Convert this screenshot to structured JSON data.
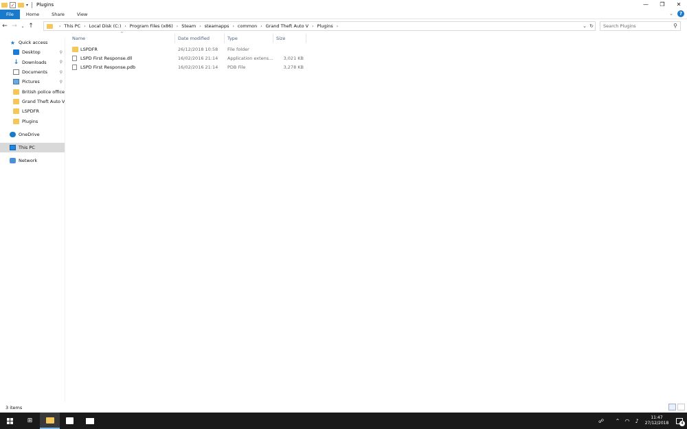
{
  "window": {
    "title": "Plugins",
    "controls": {
      "minimize": "—",
      "restore": "❐",
      "close": "✕"
    }
  },
  "ribbon": {
    "tabs": [
      "File",
      "Home",
      "Share",
      "View"
    ]
  },
  "address": {
    "crumbs": [
      "This PC",
      "Local Disk (C:)",
      "Program Files (x86)",
      "Steam",
      "steamapps",
      "common",
      "Grand Theft Auto V",
      "Plugins"
    ],
    "search_placeholder": "Search Plugins"
  },
  "nav_pane": {
    "quick_access": "Quick access",
    "pinned": [
      "Desktop",
      "Downloads",
      "Documents",
      "Pictures"
    ],
    "folders": [
      "British police officer",
      "Grand Theft Auto V",
      "LSPDFR",
      "Plugins"
    ],
    "onedrive": "OneDrive",
    "this_pc": "This PC",
    "network": "Network"
  },
  "columns": {
    "name": "Name",
    "date": "Date modified",
    "type": "Type",
    "size": "Size"
  },
  "files": [
    {
      "name": "LSPDFR",
      "date": "26/12/2018 10:58",
      "type": "File folder",
      "size": "",
      "icon": "folder-icon"
    },
    {
      "name": "LSPD First Response.dll",
      "date": "16/02/2016 21:14",
      "type": "Application extens...",
      "size": "3,021 KB",
      "icon": "file-icon"
    },
    {
      "name": "LSPD First Response.pdb",
      "date": "16/02/2016 21:14",
      "type": "PDB File",
      "size": "3,278 KB",
      "icon": "file-icon"
    }
  ],
  "status": {
    "count": "3 items"
  },
  "taskbar": {
    "time": "11:47",
    "date": "27/12/2018",
    "notifications": "4"
  },
  "colors": {
    "accent": "#1979ca",
    "folder": "#f5c75a",
    "taskbar": "#1a1a1a"
  }
}
